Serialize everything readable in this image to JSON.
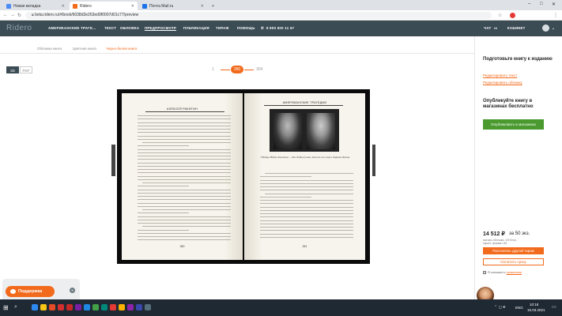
{
  "tabs": [
    {
      "label": "Новая вкладка",
      "fav_color": "#4c8bf5"
    },
    {
      "label": "Ridero",
      "fav_color": "#f26a1b"
    },
    {
      "label": "Почта Mail.ru",
      "fav_color": "#1a73e8"
    }
  ],
  "address": {
    "url": "beta.ridero.ru/#/book/6038d3e263ed9f0007d01c77/preview"
  },
  "site": {
    "logo": "Ridero",
    "nav": [
      "АМЕРИКАНСКИЕ ТРАГЕ...",
      "ТЕКСТ",
      "ОБЛОЖКА",
      "ПРЕДПРОСМОТР",
      "ПУБЛИКАЦИЯ",
      "ТИРАЖ",
      "ПОМОЩЬ"
    ],
    "phone": "8 800 500 11 67",
    "chat": "ЧАТ",
    "cabinet": "КАБИНЕТ"
  },
  "subnav": [
    "Обложка книги",
    "Цветная книга",
    "Черно-белая книга"
  ],
  "format": {
    "a": "3D",
    "b": "PDF"
  },
  "pager": {
    "first": "1",
    "current": "260",
    "last": "304"
  },
  "book": {
    "left_header": "АЛЕКСЕЙ РАКИТИН",
    "right_header": "АМЕРИКАНСКИЕ ТРАГЕДИИ",
    "photo_caption": "Убийцы Нэйва Лонгмэна — Пол Хэйни (слева, кто-то же сам) и Хартон Путни",
    "left_page_num": "260",
    "right_page_num": "261"
  },
  "sidebar": {
    "prepare_title": "Подготовьте книгу к изданию",
    "edit_text": "Редактировать текст",
    "edit_cover": "Редактировать обложку",
    "publish_title": "Опубликуйте книгу в магазинах бесплатно",
    "publish_btn": "Опубликовать в магазинах",
    "price": "14 512 ₽",
    "price_for": "за 50 экз.",
    "price_note1": "мягкая обложка, ч/б блок,",
    "price_note2": "офсет, формат A5",
    "calc_btn": "Рассчитать другой тираж",
    "pay_btn": "Оплатить сразу",
    "agree_prefix": "Я согласен с",
    "agree_link": "правилами"
  },
  "support": {
    "label": "Поддержка"
  },
  "taskbar": {
    "lang": "ENG",
    "time": "10:18",
    "date": "16.03.2021"
  },
  "colors": {
    "accent": "#f26a1b",
    "header": "#3b4c55",
    "green": "#4a9a2f"
  }
}
